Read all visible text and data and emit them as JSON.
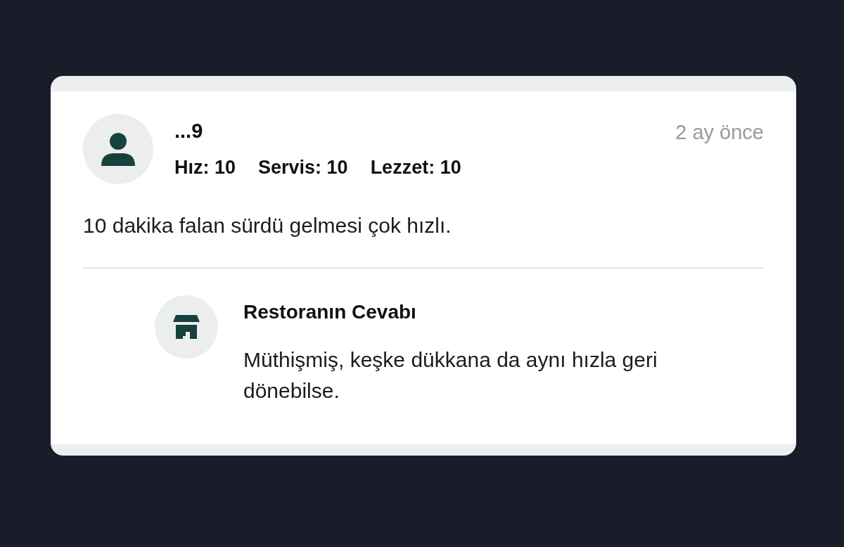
{
  "review": {
    "author": "...9",
    "time": "2 ay önce",
    "ratings": [
      "Hız: 10",
      "Servis: 10",
      "Lezzet: 10"
    ],
    "text": "10 dakika falan sürdü gelmesi çok hızlı."
  },
  "reply": {
    "title": "Restoranın Cevabı",
    "text": "Müthişmiş, keşke dükkana da aynı hızla geri dönebilse."
  }
}
